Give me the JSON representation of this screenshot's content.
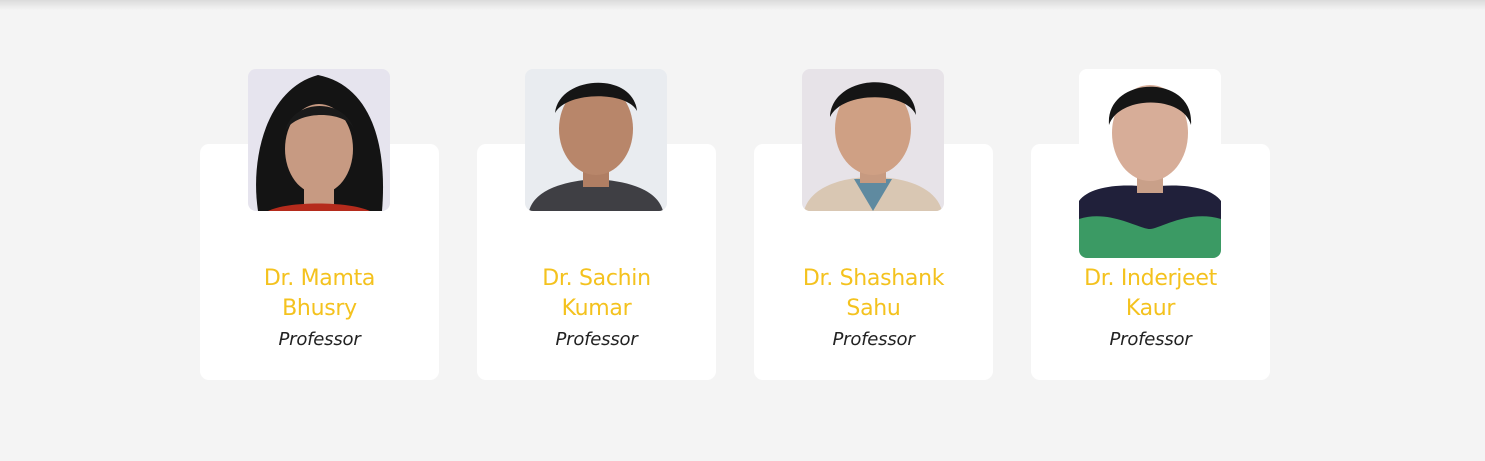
{
  "faculty": [
    {
      "name_line1": "Dr. Mamta",
      "name_line2": "Bhusry",
      "title": "Professor",
      "photo": "portrait-photo"
    },
    {
      "name_line1": "Dr. Sachin",
      "name_line2": "Kumar",
      "title": "Professor",
      "photo": "portrait-photo"
    },
    {
      "name_line1": "Dr. Shashank",
      "name_line2": "Sahu",
      "title": "Professor",
      "photo": "portrait-photo"
    },
    {
      "name_line1": "Dr. Inderjeet",
      "name_line2": "Kaur",
      "title": "Professor",
      "photo": "portrait-photo"
    }
  ],
  "colors": {
    "page_background": "#f4f4f4",
    "card_background": "#ffffff",
    "name_color": "#f4c21e",
    "title_color": "#222222"
  }
}
